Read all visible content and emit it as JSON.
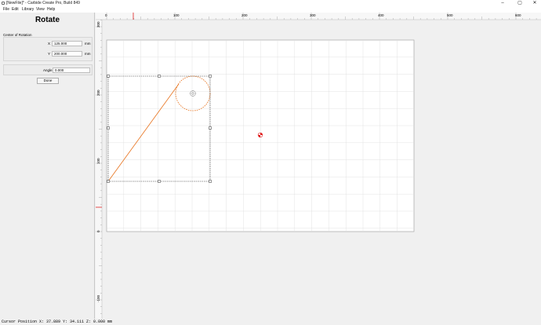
{
  "window": {
    "title": "[NewFile]* - Carbide Create Pro, Build 849",
    "controls": {
      "minimize": "–",
      "maximize": "▢",
      "close": "✕"
    }
  },
  "menu": [
    "File",
    "Edit",
    "Library",
    "View",
    "Help"
  ],
  "panel": {
    "title": "Rotate",
    "center_label": "Center of Rotation",
    "x_label": "X",
    "x_value": "125.000",
    "y_label": "Y",
    "y_value": "200.000",
    "unit": "mm",
    "angle_label": "Angle",
    "angle_value": "0.000",
    "done_label": "Done"
  },
  "ruler": {
    "top_ticks": [
      "0",
      "100",
      "200",
      "300",
      "400",
      "500",
      "600"
    ],
    "left_ticks": [
      "300",
      "200",
      "100",
      "0",
      "-100"
    ]
  },
  "colors": {
    "accent": "#e8721c",
    "marker": "#e02020",
    "selection": "#333333"
  },
  "status": {
    "cursor": "Cursor Position X: 37.889 Y: 34.111 Z: 0.000 mm"
  }
}
